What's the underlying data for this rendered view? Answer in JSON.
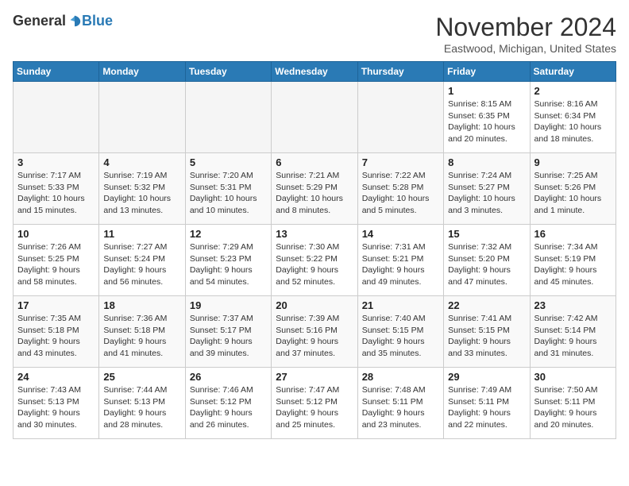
{
  "header": {
    "logo_general": "General",
    "logo_blue": "Blue",
    "month_title": "November 2024",
    "location": "Eastwood, Michigan, United States"
  },
  "weekdays": [
    "Sunday",
    "Monday",
    "Tuesday",
    "Wednesday",
    "Thursday",
    "Friday",
    "Saturday"
  ],
  "weeks": [
    [
      {
        "day": "",
        "sunrise": "",
        "sunset": "",
        "daylight": ""
      },
      {
        "day": "",
        "sunrise": "",
        "sunset": "",
        "daylight": ""
      },
      {
        "day": "",
        "sunrise": "",
        "sunset": "",
        "daylight": ""
      },
      {
        "day": "",
        "sunrise": "",
        "sunset": "",
        "daylight": ""
      },
      {
        "day": "",
        "sunrise": "",
        "sunset": "",
        "daylight": ""
      },
      {
        "day": "1",
        "sunrise": "Sunrise: 8:15 AM",
        "sunset": "Sunset: 6:35 PM",
        "daylight": "Daylight: 10 hours and 20 minutes."
      },
      {
        "day": "2",
        "sunrise": "Sunrise: 8:16 AM",
        "sunset": "Sunset: 6:34 PM",
        "daylight": "Daylight: 10 hours and 18 minutes."
      }
    ],
    [
      {
        "day": "3",
        "sunrise": "Sunrise: 7:17 AM",
        "sunset": "Sunset: 5:33 PM",
        "daylight": "Daylight: 10 hours and 15 minutes."
      },
      {
        "day": "4",
        "sunrise": "Sunrise: 7:19 AM",
        "sunset": "Sunset: 5:32 PM",
        "daylight": "Daylight: 10 hours and 13 minutes."
      },
      {
        "day": "5",
        "sunrise": "Sunrise: 7:20 AM",
        "sunset": "Sunset: 5:31 PM",
        "daylight": "Daylight: 10 hours and 10 minutes."
      },
      {
        "day": "6",
        "sunrise": "Sunrise: 7:21 AM",
        "sunset": "Sunset: 5:29 PM",
        "daylight": "Daylight: 10 hours and 8 minutes."
      },
      {
        "day": "7",
        "sunrise": "Sunrise: 7:22 AM",
        "sunset": "Sunset: 5:28 PM",
        "daylight": "Daylight: 10 hours and 5 minutes."
      },
      {
        "day": "8",
        "sunrise": "Sunrise: 7:24 AM",
        "sunset": "Sunset: 5:27 PM",
        "daylight": "Daylight: 10 hours and 3 minutes."
      },
      {
        "day": "9",
        "sunrise": "Sunrise: 7:25 AM",
        "sunset": "Sunset: 5:26 PM",
        "daylight": "Daylight: 10 hours and 1 minute."
      }
    ],
    [
      {
        "day": "10",
        "sunrise": "Sunrise: 7:26 AM",
        "sunset": "Sunset: 5:25 PM",
        "daylight": "Daylight: 9 hours and 58 minutes."
      },
      {
        "day": "11",
        "sunrise": "Sunrise: 7:27 AM",
        "sunset": "Sunset: 5:24 PM",
        "daylight": "Daylight: 9 hours and 56 minutes."
      },
      {
        "day": "12",
        "sunrise": "Sunrise: 7:29 AM",
        "sunset": "Sunset: 5:23 PM",
        "daylight": "Daylight: 9 hours and 54 minutes."
      },
      {
        "day": "13",
        "sunrise": "Sunrise: 7:30 AM",
        "sunset": "Sunset: 5:22 PM",
        "daylight": "Daylight: 9 hours and 52 minutes."
      },
      {
        "day": "14",
        "sunrise": "Sunrise: 7:31 AM",
        "sunset": "Sunset: 5:21 PM",
        "daylight": "Daylight: 9 hours and 49 minutes."
      },
      {
        "day": "15",
        "sunrise": "Sunrise: 7:32 AM",
        "sunset": "Sunset: 5:20 PM",
        "daylight": "Daylight: 9 hours and 47 minutes."
      },
      {
        "day": "16",
        "sunrise": "Sunrise: 7:34 AM",
        "sunset": "Sunset: 5:19 PM",
        "daylight": "Daylight: 9 hours and 45 minutes."
      }
    ],
    [
      {
        "day": "17",
        "sunrise": "Sunrise: 7:35 AM",
        "sunset": "Sunset: 5:18 PM",
        "daylight": "Daylight: 9 hours and 43 minutes."
      },
      {
        "day": "18",
        "sunrise": "Sunrise: 7:36 AM",
        "sunset": "Sunset: 5:18 PM",
        "daylight": "Daylight: 9 hours and 41 minutes."
      },
      {
        "day": "19",
        "sunrise": "Sunrise: 7:37 AM",
        "sunset": "Sunset: 5:17 PM",
        "daylight": "Daylight: 9 hours and 39 minutes."
      },
      {
        "day": "20",
        "sunrise": "Sunrise: 7:39 AM",
        "sunset": "Sunset: 5:16 PM",
        "daylight": "Daylight: 9 hours and 37 minutes."
      },
      {
        "day": "21",
        "sunrise": "Sunrise: 7:40 AM",
        "sunset": "Sunset: 5:15 PM",
        "daylight": "Daylight: 9 hours and 35 minutes."
      },
      {
        "day": "22",
        "sunrise": "Sunrise: 7:41 AM",
        "sunset": "Sunset: 5:15 PM",
        "daylight": "Daylight: 9 hours and 33 minutes."
      },
      {
        "day": "23",
        "sunrise": "Sunrise: 7:42 AM",
        "sunset": "Sunset: 5:14 PM",
        "daylight": "Daylight: 9 hours and 31 minutes."
      }
    ],
    [
      {
        "day": "24",
        "sunrise": "Sunrise: 7:43 AM",
        "sunset": "Sunset: 5:13 PM",
        "daylight": "Daylight: 9 hours and 30 minutes."
      },
      {
        "day": "25",
        "sunrise": "Sunrise: 7:44 AM",
        "sunset": "Sunset: 5:13 PM",
        "daylight": "Daylight: 9 hours and 28 minutes."
      },
      {
        "day": "26",
        "sunrise": "Sunrise: 7:46 AM",
        "sunset": "Sunset: 5:12 PM",
        "daylight": "Daylight: 9 hours and 26 minutes."
      },
      {
        "day": "27",
        "sunrise": "Sunrise: 7:47 AM",
        "sunset": "Sunset: 5:12 PM",
        "daylight": "Daylight: 9 hours and 25 minutes."
      },
      {
        "day": "28",
        "sunrise": "Sunrise: 7:48 AM",
        "sunset": "Sunset: 5:11 PM",
        "daylight": "Daylight: 9 hours and 23 minutes."
      },
      {
        "day": "29",
        "sunrise": "Sunrise: 7:49 AM",
        "sunset": "Sunset: 5:11 PM",
        "daylight": "Daylight: 9 hours and 22 minutes."
      },
      {
        "day": "30",
        "sunrise": "Sunrise: 7:50 AM",
        "sunset": "Sunset: 5:11 PM",
        "daylight": "Daylight: 9 hours and 20 minutes."
      }
    ]
  ]
}
